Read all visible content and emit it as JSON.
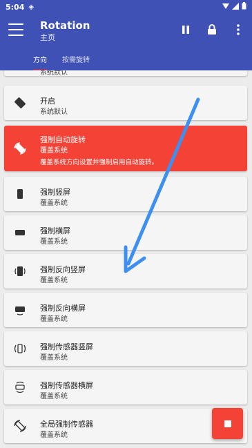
{
  "status_bar": {
    "time": "5:04"
  },
  "app_bar": {
    "title": "Rotation",
    "subtitle": "主页"
  },
  "tabs": [
    {
      "label": "方向",
      "active": true
    },
    {
      "label": "按需旋转",
      "active": false
    }
  ],
  "list": {
    "partial_top": {
      "sub": "系统默认"
    },
    "items": [
      {
        "label": "开启",
        "sub": "系统默认",
        "icon": "rotate-on-icon"
      },
      {
        "label": "强制自动旋转",
        "sub": "覆盖系统",
        "desc": "覆盖系统方向设置并强制启用自动旋转。",
        "icon": "auto-rotate-icon",
        "active": true
      },
      {
        "label": "强制竖屏",
        "sub": "覆盖系统",
        "icon": "portrait-icon"
      },
      {
        "label": "强制横屏",
        "sub": "覆盖系统",
        "icon": "landscape-icon"
      },
      {
        "label": "强制反向竖屏",
        "sub": "覆盖系统",
        "icon": "reverse-portrait-icon"
      },
      {
        "label": "强制反向横屏",
        "sub": "覆盖系统",
        "icon": "reverse-landscape-icon"
      },
      {
        "label": "强制传感器竖屏",
        "sub": "覆盖系统",
        "icon": "sensor-portrait-icon"
      },
      {
        "label": "强制传感器横屏",
        "sub": "覆盖系统",
        "icon": "sensor-landscape-icon"
      },
      {
        "label": "全局强制传感器",
        "sub": "覆盖系统",
        "icon": "global-sensor-icon"
      }
    ]
  },
  "colors": {
    "primary": "#3f51b5",
    "accent": "#f44336",
    "annotation_arrow": "#3d8ff0"
  }
}
